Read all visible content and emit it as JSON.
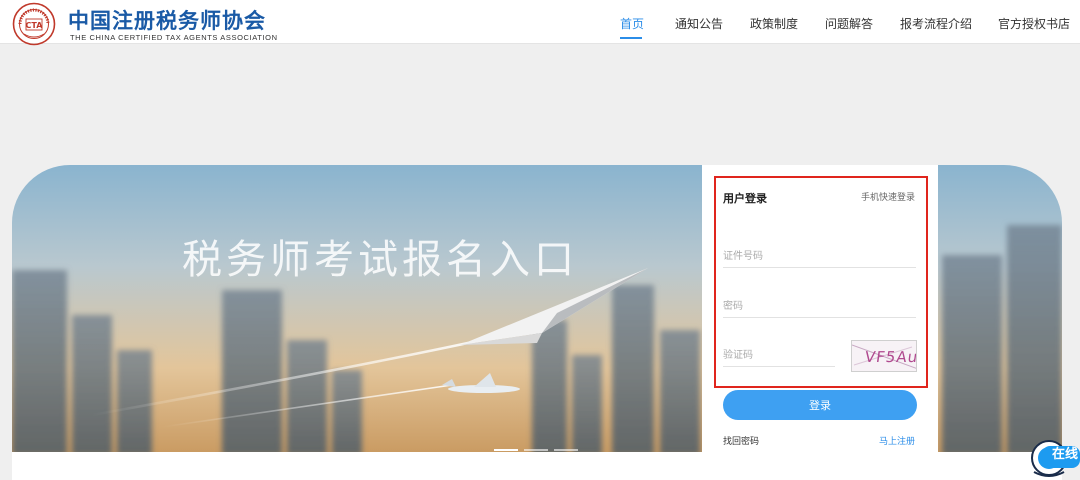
{
  "header": {
    "org_name_cn": "中国注册税务师协会",
    "org_name_en": "THE CHINA CERTIFIED TAX AGENTS ASSOCIATION",
    "seal_text": "CTA"
  },
  "nav": {
    "items": [
      {
        "label": "首页",
        "active": true
      },
      {
        "label": "通知公告",
        "active": false
      },
      {
        "label": "政策制度",
        "active": false
      },
      {
        "label": "问题解答",
        "active": false
      },
      {
        "label": "报考流程介绍",
        "active": false
      },
      {
        "label": "官方授权书店",
        "active": false
      }
    ],
    "accent_color": "#2b8de8"
  },
  "banner": {
    "title": "税务师考试报名入口",
    "slide_count": 3,
    "active_slide": 1
  },
  "login": {
    "title": "用户登录",
    "quick_login": "手机快速登录",
    "id_placeholder": "证件号码",
    "password_placeholder": "密码",
    "captcha_placeholder": "验证码",
    "captcha_text": "VF5Au",
    "submit_label": "登录",
    "forgot_label": "找回密码",
    "register_label": "马上注册",
    "button_color": "#3ea0f2",
    "highlight_color": "#e0251d"
  },
  "chat": {
    "label": "在线"
  }
}
